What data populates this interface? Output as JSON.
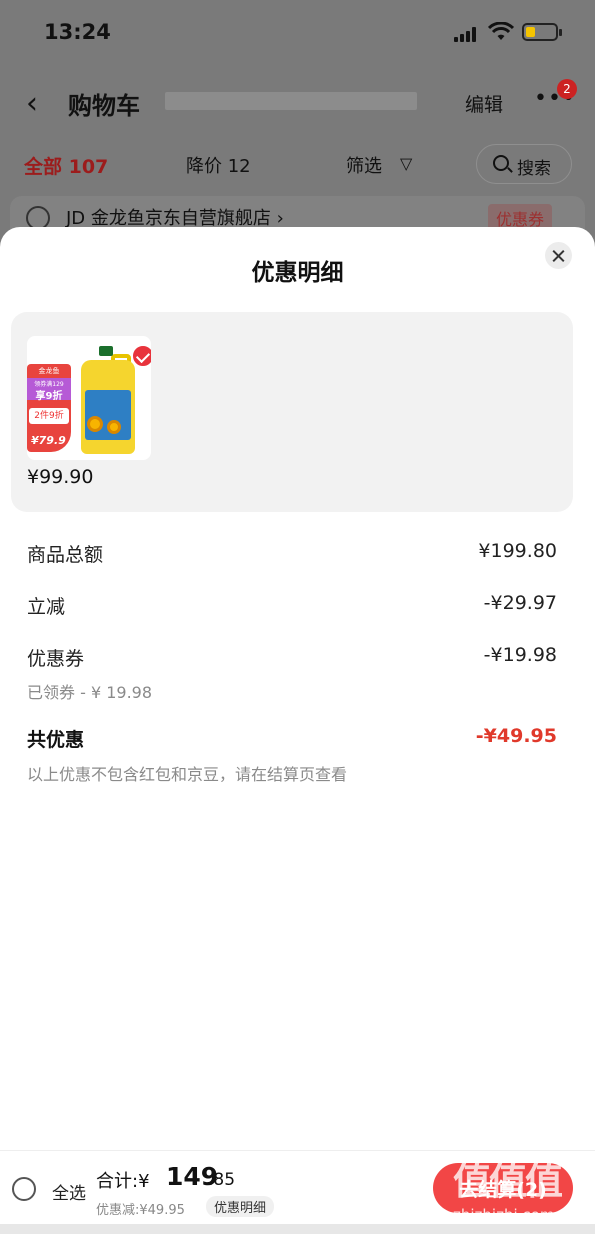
{
  "status_bar": {
    "time": "13:24"
  },
  "nav": {
    "title": "购物车",
    "edit": "编辑",
    "more_badge": "2"
  },
  "tabs": {
    "all": "全部 107",
    "price_drop": "降价 12",
    "filter": "筛选",
    "search": "搜索"
  },
  "store": {
    "name": "JD 金龙鱼京东自营旗舰店 ›",
    "coupon_tag": "优惠券"
  },
  "sheet": {
    "title": "优惠明细",
    "product": {
      "price": "¥99.90",
      "promo_top": "金龙鱼",
      "promo_line1": "领券满129",
      "promo_line2": "享9折",
      "promo_tag": "2件9折",
      "promo_price": "¥79.9"
    },
    "rows": {
      "subtotal_label": "商品总额",
      "subtotal_value": "¥199.80",
      "instant_label": "立减",
      "instant_value": "-¥29.97",
      "coupon_label": "优惠券",
      "coupon_value": "-¥19.98",
      "coupon_sub": "已领券 - ¥ 19.98",
      "total_label": "共优惠",
      "total_value": "-¥49.95",
      "note": "以上优惠不包含红包和京豆，请在结算页查看"
    }
  },
  "bottom_bar": {
    "select_all": "全选",
    "total_label": "合计:¥",
    "total_int": "149",
    "total_dec": ".85",
    "discount": "优惠减:¥49.95",
    "detail": "优惠明细",
    "checkout": "去结算(2)"
  },
  "watermark": {
    "logo": "值值值",
    "text": "zhizhizhi.com"
  },
  "colors": {
    "accent": "#e0392b",
    "checkout": "#f24646"
  }
}
